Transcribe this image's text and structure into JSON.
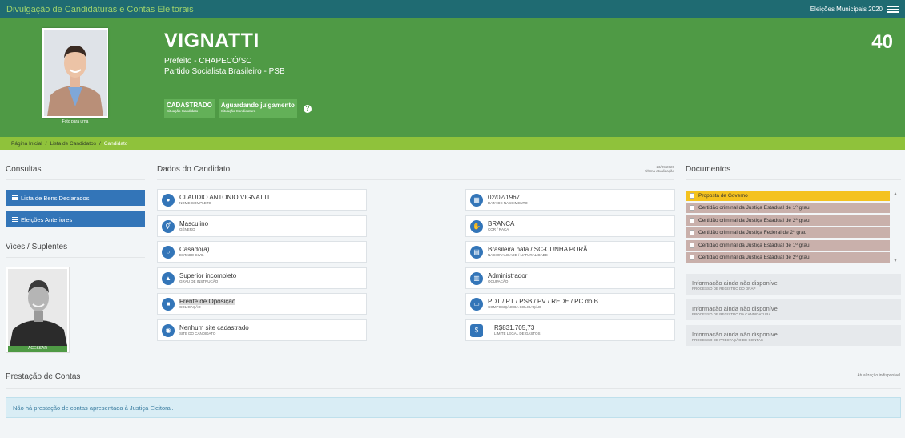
{
  "topbar": {
    "app_title": "Divulgação de Candidaturas e Contas Eleitorais",
    "election": "Eleições Municipais 2020"
  },
  "candidate": {
    "name": "VIGNATTI",
    "office_line": "Prefeito - CHAPECÓ/SC",
    "party_line": "Partido Socialista Brasileiro - PSB",
    "number": "40",
    "photo_caption": "Foto para urna"
  },
  "status": {
    "registration": {
      "title": "CADASTRADO",
      "sub": "Situação Candidato"
    },
    "candidacy": {
      "title": "Aguardando julgamento",
      "sub": "Situação Candidatura"
    }
  },
  "breadcrumb": {
    "home": "Página Inicial",
    "list": "Lista de Candidatos",
    "current": "Candidato",
    "sep": "/"
  },
  "consultas": {
    "title": "Consultas",
    "bens_label": "Lista de Bens Declarados",
    "eleicoes_label": "Eleições Anteriores"
  },
  "vices": {
    "title": "Vices / Suplentes",
    "button_label": "ACESSAR"
  },
  "dados": {
    "title": "Dados do Candidato",
    "last_update_date": "23/09/2020",
    "last_update_label": "Última atualização",
    "left": [
      {
        "value": "CLAUDIO ANTONIO VIGNATTI",
        "label": "NOME COMPLETO"
      },
      {
        "value": "Masculino",
        "label": "GÊNERO"
      },
      {
        "value": "Casado(a)",
        "label": "ESTADO CIVIL"
      },
      {
        "value": "Superior incompleto",
        "label": "GRAU DE INSTRUÇÃO"
      },
      {
        "value": "Frente de Oposição",
        "label": "COLIGAÇÃO"
      },
      {
        "value": "Nenhum site cadastrado",
        "label": "SITE DO CANDIDATO"
      }
    ],
    "right": [
      {
        "value": "02/02/1967",
        "label": "DATA DE NASCIMENTO"
      },
      {
        "value": "BRANCA",
        "label": "COR / RAÇA"
      },
      {
        "value": "Brasileira nata / SC-CUNHA PORÃ",
        "label": "NACIONALIDADE / NATURALIDADE"
      },
      {
        "value": "Administrador",
        "label": "OCUPAÇÃO"
      },
      {
        "value": "PDT / PT / PSB / PV / REDE / PC do B",
        "label": "COMPOSIÇÃO DA COLIGAÇÃO"
      },
      {
        "value": "R$831.705,73",
        "label": "LIMITE LEGAL DE GASTOS"
      }
    ]
  },
  "documentos": {
    "title": "Documentos",
    "items": [
      "Proposta de Governo",
      "Certidão criminal da Justiça Estadual de 1º grau",
      "Certidão criminal da Justiça Estadual de 2º grau",
      "Certidão criminal da Justiça Federal de 2º grau",
      "Certidão criminal da Justiça Estadual de 1º grau",
      "Certidão criminal da Justiça Estadual de 2º grau"
    ],
    "info_cards": [
      {
        "title": "Informação ainda não disponível",
        "sub": "PROCESSO DE REGISTRO DO DRAP"
      },
      {
        "title": "Informação ainda não disponível",
        "sub": "PROCESSO DE REGISTRO DA CANDIDATURA"
      },
      {
        "title": "Informação ainda não disponível",
        "sub": "PROCESSO DE PRESTAÇÃO DE CONTAS"
      }
    ]
  },
  "prestacao": {
    "title": "Prestação de Contas",
    "update_note": "Atualização indisponível",
    "alert": "Não há prestação de contas apresentada à Justiça Eleitoral."
  },
  "colors": {
    "topbar": "#1f6b72",
    "hero": "#4f9a45",
    "breadcrumb": "#8fc23b",
    "primary_button": "#3375b8",
    "active_doc": "#f4c21f"
  }
}
